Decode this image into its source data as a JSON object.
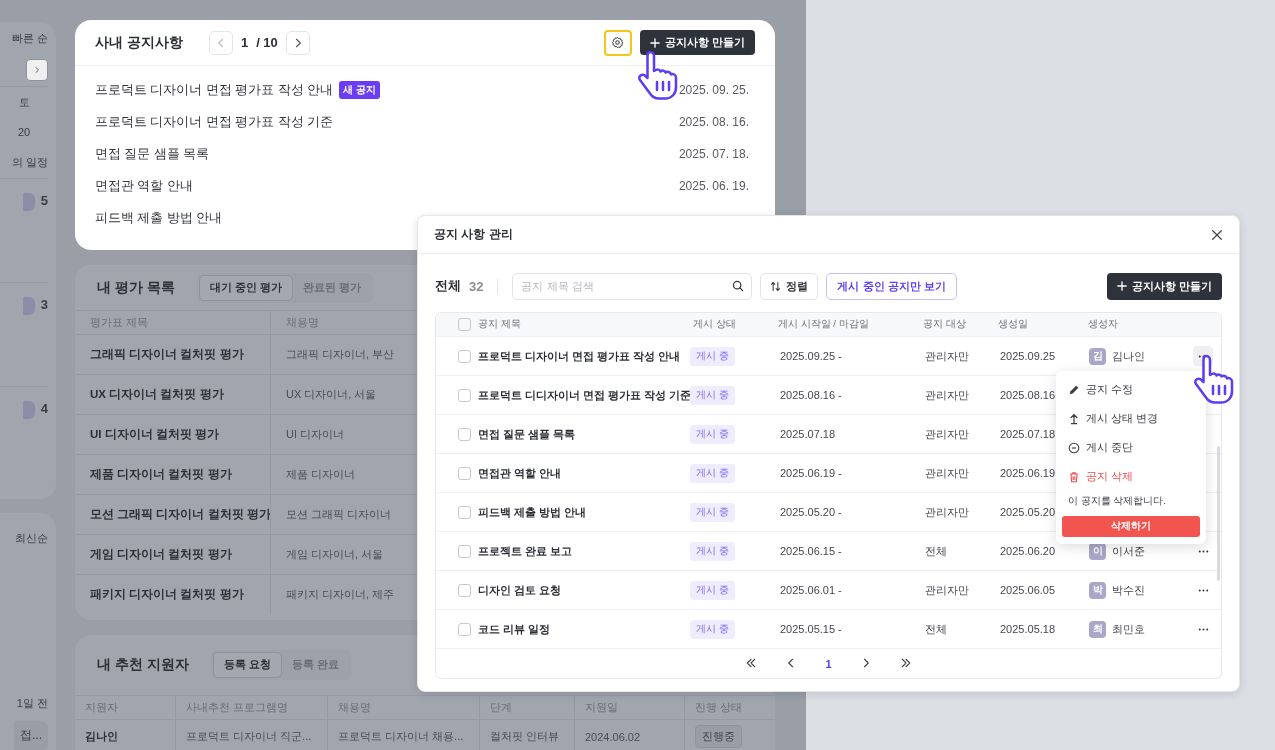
{
  "calendar_panel": {
    "sort_label": "빠른 순",
    "weekday": "토",
    "day": "20",
    "schedule_label": "의 일정",
    "counts": [
      "5",
      "3",
      "4"
    ],
    "sort_label_2": "최신순",
    "time_ago": "1일 전",
    "truncated_item": "접..."
  },
  "notice_card": {
    "title": "사내 공지사항",
    "page": "1",
    "total_pages": "/ 10",
    "settings_highlighted": true,
    "create_button": "공지사항 만들기",
    "notices": [
      {
        "title": "프로덕트 디자이너 면접 평가표 작성 안내",
        "badge": "새 공지",
        "date": "2025. 09. 25."
      },
      {
        "title": "프로덕트 디자이너 면접 평가표 작성 기준",
        "date": "2025. 08. 16."
      },
      {
        "title": "면접 질문 샘플 목록",
        "date": "2025. 07. 18."
      },
      {
        "title": "면접관 역할 안내",
        "date": "2025. 06. 19."
      },
      {
        "title": "피드백 제출 방법 안내"
      }
    ]
  },
  "evaluation_card": {
    "title": "내 평가 목록",
    "tabs": [
      {
        "label": "대기 중인 평가",
        "selected": true
      },
      {
        "label": "완료된 평가",
        "selected": false
      }
    ],
    "columns": [
      "평가표 제목",
      "채용명"
    ],
    "rows": [
      [
        "그래픽 디자이너 컬처핏 평가",
        "그래픽 디자이너, 부산"
      ],
      [
        "UX 디자이너 컬처핏 평가",
        "UX 디자이너, 서울"
      ],
      [
        "UI 디자이너 컬처핏 평가",
        "UI 디자이너"
      ],
      [
        "제품 디자이너 컬처핏 평가",
        "제품 디자이너"
      ],
      [
        "모션 그래픽 디자이너 컬처핏 평가",
        "모션 그래픽 디자이너"
      ],
      [
        "게임 디자이너 컬처핏 평가",
        "게임 디자이너, 서울"
      ],
      [
        "패키지 디자이너 컬처핏 평가",
        "패키지 디자이너, 제주"
      ]
    ]
  },
  "referral_card": {
    "title": "내 추천 지원자",
    "tabs": [
      {
        "label": "등록 요청",
        "selected": true
      },
      {
        "label": "등록 완료",
        "selected": false
      }
    ],
    "columns": [
      "지원자",
      "사내추천 프로그램명",
      "채용명",
      "단계",
      "지원일",
      "진행 상태"
    ],
    "rows": [
      {
        "applicant": "김나인",
        "program": "프로덕트 디자이너 직군...",
        "job": "프로덕트 디자이너 채용...",
        "stage": "컬처핏 인터뷰",
        "date": "2024.06.02",
        "status": "진행중"
      }
    ]
  },
  "modal": {
    "title": "공지 사항 관리",
    "total_label": "전체",
    "total_count": "32",
    "search": {
      "placeholder": "공지 제목 검색"
    },
    "sort_button": "정렬",
    "filter_button": "게시 중인 공지만 보기",
    "create_button": "공지사항 만들기",
    "all_checked": false,
    "columns": [
      "공지 제목",
      "게시 상태",
      "게시 시작일 / 마감일",
      "공지 대상",
      "생성일",
      "생성자"
    ],
    "rows": [
      {
        "checked": false,
        "title": "프로덕트 디자이너 면접 평가표 작성 안내",
        "status": "게시 중",
        "period": "2025.09.25 -",
        "target": "관리자만",
        "created": "2025.09.25",
        "initial": "김",
        "creator": "김나인",
        "menu_open": true
      },
      {
        "checked": false,
        "title": "프로덕트 디디자이너 면접 평가표 작성 기준",
        "status": "게시 중",
        "period": "2025.08.16 -",
        "target": "관리자만",
        "created": "2025.08.16"
      },
      {
        "checked": false,
        "title": "면접 질문 샘플 목록",
        "status": "게시 중",
        "period": "2025.07.18",
        "target": "관리자만",
        "created": "2025.07.18"
      },
      {
        "checked": false,
        "title": "면접관 역할 안내",
        "status": "게시 중",
        "period": "2025.06.19 -",
        "target": "관리자만",
        "created": "2025.06.19"
      },
      {
        "checked": false,
        "title": "피드백 제출 방법 안내",
        "status": "게시 중",
        "period": "2025.05.20 -",
        "target": "관리자만",
        "created": "2025.05.20"
      },
      {
        "checked": false,
        "title": "프로젝트 완료 보고",
        "status": "게시 중",
        "period": "2025.06.15 -",
        "target": "전체",
        "created": "2025.06.20",
        "initial": "이",
        "creator": "이서준",
        "menu_open": false
      },
      {
        "checked": false,
        "title": "디자인 검토 요청",
        "status": "게시 중",
        "period": "2025.06.01 -",
        "target": "관리자만",
        "created": "2025.06.05",
        "initial": "박",
        "creator": "박수진",
        "menu_open": false
      },
      {
        "checked": false,
        "title": "코드 리뷰 일정",
        "status": "게시 중",
        "period": "2025.05.15 -",
        "target": "전체",
        "created": "2025.05.18",
        "initial": "최",
        "creator": "최민호",
        "menu_open": false
      }
    ],
    "pages": [
      {
        "label": "1",
        "selected": true
      }
    ],
    "menu": {
      "items": [
        {
          "kind": "edit",
          "label": "공지 수정"
        },
        {
          "kind": "status",
          "label": "게시 상태 변경"
        },
        {
          "kind": "stop",
          "label": "게시 중단"
        },
        {
          "kind": "delete",
          "label": "공지 삭제"
        }
      ],
      "confirm_text": "이 공지를 삭제합니다.",
      "confirm_button": "삭제하기"
    }
  }
}
